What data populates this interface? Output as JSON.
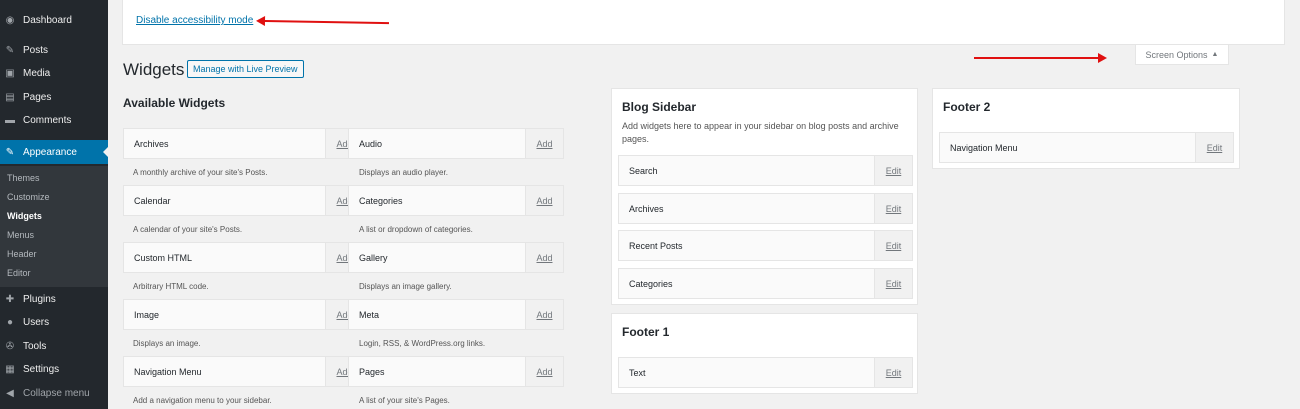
{
  "sidebar": {
    "items": [
      {
        "label": "Dashboard",
        "icon": "dashboard-icon",
        "glyph": "◉"
      },
      {
        "label": "Posts",
        "icon": "pushpin-icon",
        "glyph": "✎"
      },
      {
        "label": "Media",
        "icon": "media-icon",
        "glyph": "▣"
      },
      {
        "label": "Pages",
        "icon": "pages-icon",
        "glyph": "▤"
      },
      {
        "label": "Comments",
        "icon": "comments-icon",
        "glyph": "▬"
      },
      {
        "label": "Appearance",
        "icon": "paintbrush-icon",
        "glyph": "✎"
      }
    ],
    "submenu": [
      "Themes",
      "Customize",
      "Widgets",
      "Menus",
      "Header",
      "Editor"
    ],
    "items_lower": [
      {
        "label": "Plugins",
        "icon": "plugins-icon",
        "glyph": "✚"
      },
      {
        "label": "Users",
        "icon": "users-icon",
        "glyph": "●"
      },
      {
        "label": "Tools",
        "icon": "tools-icon",
        "glyph": "✇"
      },
      {
        "label": "Settings",
        "icon": "settings-icon",
        "glyph": "▦"
      },
      {
        "label": "Collapse menu",
        "icon": "collapse-icon",
        "glyph": "◀"
      }
    ]
  },
  "notice": {
    "link": "Disable accessibility mode"
  },
  "screen_options": {
    "label": "Screen Options",
    "glyph": "▲"
  },
  "header": {
    "title": "Widgets",
    "live_preview": "Manage with Live Preview"
  },
  "available": {
    "title": "Available Widgets",
    "action": "Add",
    "left": [
      {
        "title": "Archives",
        "desc": "A monthly archive of your site's Posts."
      },
      {
        "title": "Calendar",
        "desc": "A calendar of your site's Posts."
      },
      {
        "title": "Custom HTML",
        "desc": "Arbitrary HTML code."
      },
      {
        "title": "Image",
        "desc": "Displays an image."
      },
      {
        "title": "Navigation Menu",
        "desc": "Add a navigation menu to your sidebar."
      }
    ],
    "right": [
      {
        "title": "Audio",
        "desc": "Displays an audio player."
      },
      {
        "title": "Categories",
        "desc": "A list or dropdown of categories."
      },
      {
        "title": "Gallery",
        "desc": "Displays an image gallery."
      },
      {
        "title": "Meta",
        "desc": "Login, RSS, & WordPress.org links."
      },
      {
        "title": "Pages",
        "desc": "A list of your site's Pages."
      }
    ]
  },
  "areas": {
    "edit": "Edit",
    "blog_sidebar": {
      "title": "Blog Sidebar",
      "desc": "Add widgets here to appear in your sidebar on blog posts and archive pages.",
      "widgets": [
        "Search",
        "Archives",
        "Recent Posts",
        "Categories"
      ]
    },
    "footer1": {
      "title": "Footer 1",
      "widgets": [
        "Text"
      ]
    },
    "footer2": {
      "title": "Footer 2",
      "widgets": [
        "Navigation Menu"
      ]
    }
  },
  "colors": {
    "accent": "#0073aa",
    "menu_bg": "#23282d",
    "annotation_arrow": "#e01010"
  }
}
